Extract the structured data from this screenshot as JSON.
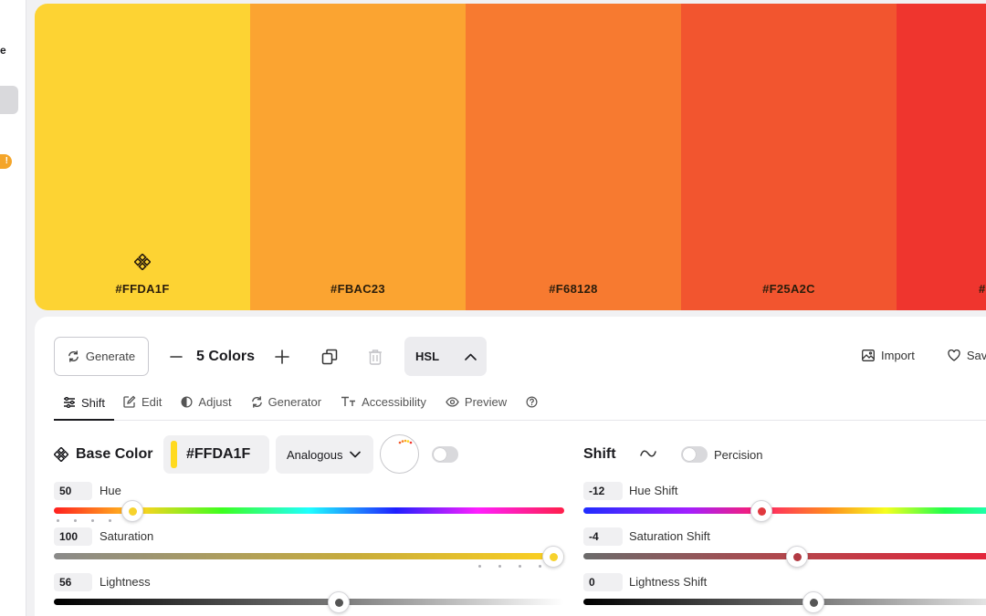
{
  "sidebar": {
    "letter": "e",
    "badge": "!"
  },
  "palette": {
    "swatches": [
      {
        "hex": "#FFDA1F",
        "color": "#FDD333"
      },
      {
        "hex": "#FBAC23",
        "color": "#FBA431"
      },
      {
        "hex": "#F68128",
        "color": "#F77A30"
      },
      {
        "hex": "#F25A2C",
        "color": "#F2552F"
      },
      {
        "hex": "#F",
        "color": "#EF352E"
      }
    ]
  },
  "toolbar": {
    "generate_label": "Generate",
    "count_label": "5 Colors",
    "mode_label": "HSL",
    "import_label": "Import",
    "save_label": "Sav"
  },
  "tabs": [
    {
      "label": "Shift"
    },
    {
      "label": "Edit"
    },
    {
      "label": "Adjust"
    },
    {
      "label": "Generator"
    },
    {
      "label": "Accessibility"
    },
    {
      "label": "Preview"
    }
  ],
  "base_color": {
    "title": "Base Color",
    "hex": "#FFDA1F",
    "harmony": "Analogous",
    "hue": {
      "value": "50",
      "label": "Hue",
      "fraction": 0.155
    },
    "saturation": {
      "value": "100",
      "label": "Saturation",
      "fraction": 1.0
    },
    "lightness": {
      "value": "56",
      "label": "Lightness",
      "fraction": 0.56
    }
  },
  "shift": {
    "title": "Shift",
    "toggle_label": "Percision",
    "hue_shift": {
      "value": "-12",
      "label": "Hue Shift"
    },
    "saturation_shift": {
      "value": "-4",
      "label": "Saturation Shift"
    },
    "lightness_shift": {
      "value": "0",
      "label": "Lightness Shift"
    }
  },
  "colors": {
    "accent": "#FFDA1F",
    "hue_dot": "#F7D22C",
    "sat_dot": "#E0383E"
  }
}
